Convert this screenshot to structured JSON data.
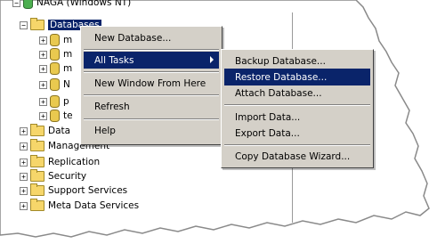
{
  "tree": {
    "server": "NAGA (Windows NT)",
    "databases": "Databases",
    "items": [
      "m",
      "m",
      "m",
      "N",
      "p",
      "te"
    ],
    "data": "Data",
    "management": "Management",
    "replication": "Replication",
    "security": "Security",
    "support": "Support Services",
    "meta": "Meta Data Services"
  },
  "context_menu": {
    "new_database": "New Database...",
    "all_tasks": "All Tasks",
    "new_window": "New Window From Here",
    "refresh": "Refresh",
    "help": "Help"
  },
  "submenu": {
    "backup": "Backup Database...",
    "restore": "Restore Database...",
    "attach": "Attach Database...",
    "import": "Import Data...",
    "export": "Export Data...",
    "wizard": "Copy Database Wizard..."
  },
  "colors": {
    "highlight": "#0a246a",
    "menu_bg": "#d4d0c8"
  }
}
